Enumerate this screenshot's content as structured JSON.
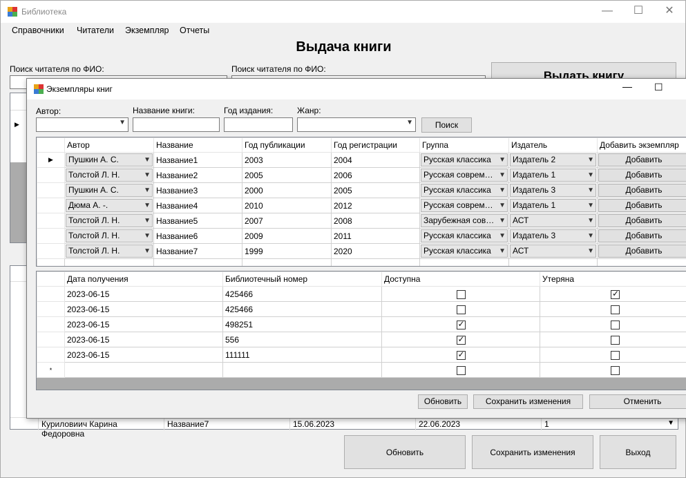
{
  "window": {
    "title": "Библиотека"
  },
  "menu": [
    "Справочники",
    "Читатели",
    "Экземпляр",
    "Отчеты"
  ],
  "main": {
    "heading": "Выдача книги",
    "search_reader_label_1": "Поиск читателя по ФИО:",
    "search_reader_label_2": "Поиск читателя по ФИО:",
    "issue_button": "Выдать книгу",
    "bottom_row": {
      "reader": "Куриловиич Карина Федоровна",
      "book": "Название7",
      "date_issue": "15.06.2023",
      "date_return": "22.06.2023",
      "copy": "1"
    },
    "refresh_button": "Обновить",
    "save_button": "Сохранить изменения",
    "exit_button": "Выход"
  },
  "modal": {
    "title": "Экземпляры книг",
    "filters": {
      "author_label": "Автор:",
      "title_label": "Название книги:",
      "year_label": "Год издания:",
      "genre_label": "Жанр:",
      "search_button": "Поиск"
    },
    "books_grid": {
      "columns": [
        "Автор",
        "Название",
        "Год публикации",
        "Год регистрации",
        "Группа",
        "Издатель",
        "Добавить экземпляр"
      ],
      "rows": [
        [
          "Пушкин А. С.",
          "Название1",
          "2003",
          "2004",
          "Русская классика",
          "Издатель 2",
          "Добавить"
        ],
        [
          "Толстой Л. Н.",
          "Название2",
          "2005",
          "2006",
          "Русская современная",
          "Издатель 1",
          "Добавить"
        ],
        [
          "Пушкин А. С.",
          "Название3",
          "2000",
          "2005",
          "Русская классика",
          "Издатель 3",
          "Добавить"
        ],
        [
          "Дюма А. -.",
          "Название4",
          "2010",
          "2012",
          "Русская современная",
          "Издатель 1",
          "Добавить"
        ],
        [
          "Толстой Л. Н.",
          "Название5",
          "2007",
          "2008",
          "Зарубежная современная",
          "АСТ",
          "Добавить"
        ],
        [
          "Толстой Л. Н.",
          "Название6",
          "2009",
          "2011",
          "Русская классика",
          "Издатель 3",
          "Добавить"
        ],
        [
          "Толстой Л. Н.",
          "Название7",
          "1999",
          "2020",
          "Русская классика",
          "АСТ",
          "Добавить"
        ]
      ]
    },
    "copies_grid": {
      "columns": [
        "Дата получения",
        "Библиотечный номер",
        "Доступна",
        "Утеряна"
      ],
      "rows": [
        {
          "date": "2023-06-15",
          "number": "425466",
          "available": false,
          "lost": true
        },
        {
          "date": "2023-06-15",
          "number": "425466",
          "available": false,
          "lost": false
        },
        {
          "date": "2023-06-15",
          "number": "498251",
          "available": true,
          "lost": false
        },
        {
          "date": "2023-06-15",
          "number": "556",
          "available": true,
          "lost": false
        },
        {
          "date": "2023-06-15",
          "number": "111111",
          "available": true,
          "lost": false
        }
      ],
      "new_row_marker": "*"
    },
    "refresh_button": "Обновить",
    "save_button": "Сохранить изменения",
    "cancel_button": "Отменить"
  }
}
